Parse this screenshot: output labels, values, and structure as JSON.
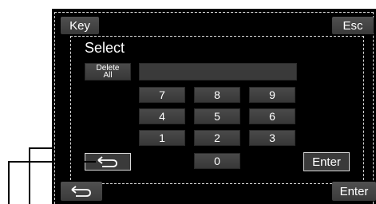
{
  "topbar": {
    "key_label": "Key",
    "esc_label": "Esc"
  },
  "dialog": {
    "title": "Select",
    "delete_all_label": "Delete\nAll",
    "input_value": "",
    "keypad": [
      "7",
      "8",
      "9",
      "4",
      "5",
      "6",
      "1",
      "2",
      "3",
      "0"
    ],
    "enter_label": "Enter",
    "back_icon": "return-arrow-icon"
  },
  "bottombar": {
    "enter_label": "Enter",
    "back_icon": "return-arrow-icon"
  }
}
